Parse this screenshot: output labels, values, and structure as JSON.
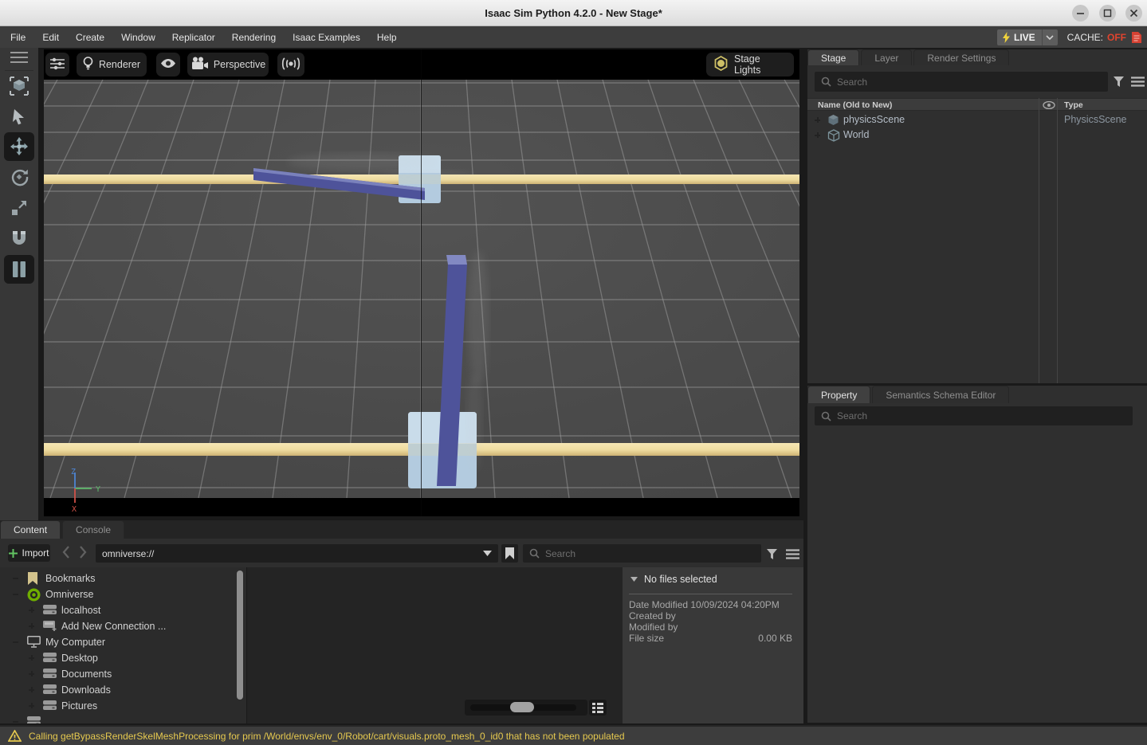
{
  "window": {
    "title": "Isaac Sim Python 4.2.0 - New Stage*"
  },
  "menu_bar": {
    "items": [
      "File",
      "Edit",
      "Create",
      "Window",
      "Replicator",
      "Rendering",
      "Isaac Examples",
      "Help"
    ],
    "live_label": "LIVE",
    "cache_label": "CACHE:",
    "cache_value": "OFF"
  },
  "left_toolbar": {
    "tools": [
      {
        "name": "view-options",
        "icon": "lines3",
        "active": false
      },
      {
        "name": "selection-mode",
        "icon": "cube-select",
        "active": false
      },
      {
        "name": "select-tool",
        "icon": "cursor",
        "active": false
      },
      {
        "name": "move-tool",
        "icon": "move",
        "active": true
      },
      {
        "name": "rotate-tool",
        "icon": "rotate",
        "active": false
      },
      {
        "name": "scale-tool",
        "icon": "scale",
        "active": false
      },
      {
        "name": "snap-tool",
        "icon": "magnet",
        "active": false
      },
      {
        "name": "play-pause",
        "icon": "pause",
        "active": true
      }
    ]
  },
  "viewport": {
    "toolbar": {
      "renderer_label": "Renderer",
      "camera_label": "Perspective",
      "stage_lights_label": "Stage Lights"
    },
    "axis": {
      "x": "X",
      "y": "Y",
      "z": "Z"
    }
  },
  "stage_panel": {
    "tabs": [
      {
        "label": "Stage",
        "active": true
      },
      {
        "label": "Layer",
        "active": false
      },
      {
        "label": "Render Settings",
        "active": false
      }
    ],
    "search_placeholder": "Search",
    "columns": {
      "name": "Name (Old to New)",
      "type": "Type"
    },
    "rows": [
      {
        "name": "physicsScene",
        "icon": "cube-solid",
        "type": "PhysicsScene"
      },
      {
        "name": "World",
        "icon": "cube-wire",
        "type": ""
      }
    ]
  },
  "property_panel": {
    "tabs": [
      {
        "label": "Property",
        "active": true
      },
      {
        "label": "Semantics Schema Editor",
        "active": false
      }
    ],
    "search_placeholder": "Search"
  },
  "content_browser": {
    "tabs": [
      {
        "label": "Content",
        "active": true
      },
      {
        "label": "Console",
        "active": false
      }
    ],
    "import_label": "Import",
    "path_value": "omniverse://",
    "search_placeholder": "Search",
    "tree": [
      {
        "label": "Bookmarks",
        "icon": "bookmark",
        "level": 0,
        "expanded": true
      },
      {
        "label": "Omniverse",
        "icon": "omniverse",
        "level": 0,
        "expanded": true
      },
      {
        "label": "localhost",
        "icon": "drive",
        "level": 1,
        "expanded": false
      },
      {
        "label": "Add New Connection ...",
        "icon": "drive-add",
        "level": 1,
        "expanded": false
      },
      {
        "label": "My Computer",
        "icon": "computer",
        "level": 0,
        "expanded": true
      },
      {
        "label": "Desktop",
        "icon": "drive",
        "level": 1,
        "expanded": false
      },
      {
        "label": "Documents",
        "icon": "drive",
        "level": 1,
        "expanded": false
      },
      {
        "label": "Downloads",
        "icon": "drive",
        "level": 1,
        "expanded": false
      },
      {
        "label": "Pictures",
        "icon": "drive",
        "level": 1,
        "expanded": false
      },
      {
        "label": "",
        "icon": "drive",
        "level": 0,
        "expanded": true
      }
    ],
    "details": {
      "header": "No files selected",
      "rows": [
        {
          "label": "Date Modified",
          "value": "10/09/2024 04:20PM",
          "inline": true
        },
        {
          "label": "Created by",
          "value": "",
          "inline": true
        },
        {
          "label": "Modified by",
          "value": "",
          "inline": true
        },
        {
          "label": "File size",
          "value": "0.00 KB",
          "inline": false
        }
      ]
    }
  },
  "status_bar": {
    "message": "Calling getBypassRenderSkelMeshProcessing for prim /World/envs/env_0/Robot/cart/visuals.proto_mesh_0_id0 that has not been populated"
  },
  "colors": {
    "accent_yellow": "#f0d33c",
    "cache_off_red": "#e0442e",
    "rail": "#eedb9e",
    "rail_edge": "#cdb274",
    "pole": "#4e539a",
    "pole_light": "#8289c2",
    "cart": "#b3cbdf",
    "cart_top": "#c9dcea",
    "grid_bg": "#4b4b4b",
    "grid_line": "#a0a0a0",
    "axis_x": "#cf5148",
    "axis_y": "#5cb86a",
    "axis_z": "#4d84d2",
    "warning_yellow": "#e6c94f",
    "omniverse_green": "#76b900"
  }
}
